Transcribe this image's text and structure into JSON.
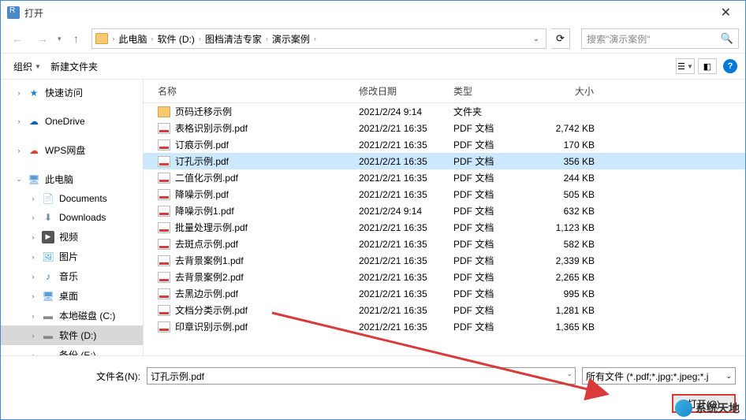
{
  "title": "打开",
  "breadcrumb": [
    "此电脑",
    "软件 (D:)",
    "图档清洁专家",
    "演示案例"
  ],
  "search_placeholder": "搜索\"演示案例\"",
  "toolbar": {
    "organize": "组织",
    "new_folder": "新建文件夹"
  },
  "sidebar": {
    "quick": "快速访问",
    "onedrive": "OneDrive",
    "wps": "WPS网盘",
    "thispc": "此电脑",
    "documents": "Documents",
    "downloads": "Downloads",
    "videos": "视频",
    "pictures": "图片",
    "music": "音乐",
    "desktop": "桌面",
    "disk_c": "本地磁盘 (C:)",
    "disk_d": "软件 (D:)",
    "disk_e": "备份 (E:)"
  },
  "columns": {
    "name": "名称",
    "date": "修改日期",
    "type": "类型",
    "size": "大小"
  },
  "files": [
    {
      "name": "页码迁移示例",
      "date": "2021/2/24 9:14",
      "type": "文件夹",
      "size": "",
      "kind": "folder"
    },
    {
      "name": "表格识别示例.pdf",
      "date": "2021/2/21 16:35",
      "type": "PDF 文档",
      "size": "2,742 KB",
      "kind": "pdf"
    },
    {
      "name": "订痕示例.pdf",
      "date": "2021/2/21 16:35",
      "type": "PDF 文档",
      "size": "170 KB",
      "kind": "pdf"
    },
    {
      "name": "订孔示例.pdf",
      "date": "2021/2/21 16:35",
      "type": "PDF 文档",
      "size": "356 KB",
      "kind": "pdf",
      "selected": true
    },
    {
      "name": "二值化示例.pdf",
      "date": "2021/2/21 16:35",
      "type": "PDF 文档",
      "size": "244 KB",
      "kind": "pdf"
    },
    {
      "name": "降噪示例.pdf",
      "date": "2021/2/21 16:35",
      "type": "PDF 文档",
      "size": "505 KB",
      "kind": "pdf"
    },
    {
      "name": "降噪示例1.pdf",
      "date": "2021/2/24 9:14",
      "type": "PDF 文档",
      "size": "632 KB",
      "kind": "pdf"
    },
    {
      "name": "批量处理示例.pdf",
      "date": "2021/2/21 16:35",
      "type": "PDF 文档",
      "size": "1,123 KB",
      "kind": "pdf"
    },
    {
      "name": "去斑点示例.pdf",
      "date": "2021/2/21 16:35",
      "type": "PDF 文档",
      "size": "582 KB",
      "kind": "pdf"
    },
    {
      "name": "去背景案例1.pdf",
      "date": "2021/2/21 16:35",
      "type": "PDF 文档",
      "size": "2,339 KB",
      "kind": "pdf"
    },
    {
      "name": "去背景案例2.pdf",
      "date": "2021/2/21 16:35",
      "type": "PDF 文档",
      "size": "2,265 KB",
      "kind": "pdf"
    },
    {
      "name": "去黑边示例.pdf",
      "date": "2021/2/21 16:35",
      "type": "PDF 文档",
      "size": "995 KB",
      "kind": "pdf"
    },
    {
      "name": "文档分类示例.pdf",
      "date": "2021/2/21 16:35",
      "type": "PDF 文档",
      "size": "1,281 KB",
      "kind": "pdf"
    },
    {
      "name": "印章识别示例.pdf",
      "date": "2021/2/21 16:35",
      "type": "PDF 文档",
      "size": "1,365 KB",
      "kind": "pdf"
    }
  ],
  "filename_label": "文件名(N):",
  "filename_value": "订孔示例.pdf",
  "filter_text": "所有文件 (*.pdf;*.jpg;*.jpeg;*.j",
  "open_btn": "打开(O)",
  "watermark": "系统天地"
}
